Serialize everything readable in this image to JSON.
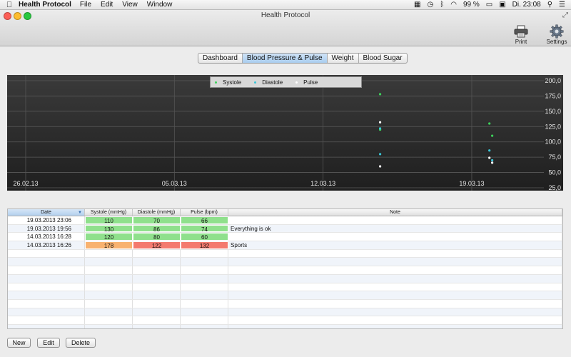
{
  "menubar": {
    "app_name": "Health Protocol",
    "items": [
      "File",
      "Edit",
      "View",
      "Window"
    ],
    "battery": "99 %",
    "clock": "Di. 23:08"
  },
  "window": {
    "title": "Health Protocol",
    "toolbar": {
      "print_label": "Print",
      "settings_label": "Settings"
    }
  },
  "tabs": [
    {
      "label": "Dashboard",
      "active": false
    },
    {
      "label": "Blood Pressure & Pulse",
      "active": true
    },
    {
      "label": "Weight",
      "active": false
    },
    {
      "label": "Blood Sugar",
      "active": false
    }
  ],
  "chart_data": {
    "type": "scatter",
    "legend": [
      {
        "name": "Systole",
        "color": "#3cd25a"
      },
      {
        "name": "Diastole",
        "color": "#39c6d8"
      },
      {
        "name": "Pulse",
        "color": "#ffffff"
      }
    ],
    "x_tick_labels": [
      "26.02.13",
      "05.03.13",
      "12.03.13",
      "19.03.13"
    ],
    "y_tick_labels": [
      "200,0",
      "175,0",
      "150,0",
      "125,0",
      "100,0",
      "75,0",
      "50,0",
      "25,0"
    ],
    "ylim": [
      25,
      200
    ],
    "xlim": [
      "2013-02-26",
      "2013-03-23"
    ],
    "series": [
      {
        "name": "Systole",
        "color": "#3cd25a",
        "points": [
          {
            "x": "2013-03-14 16:26",
            "y": 178
          },
          {
            "x": "2013-03-14 16:28",
            "y": 120
          },
          {
            "x": "2013-03-19 19:56",
            "y": 130
          },
          {
            "x": "2013-03-19 23:06",
            "y": 110
          }
        ]
      },
      {
        "name": "Diastole",
        "color": "#39c6d8",
        "points": [
          {
            "x": "2013-03-14 16:26",
            "y": 122
          },
          {
            "x": "2013-03-14 16:28",
            "y": 80
          },
          {
            "x": "2013-03-19 19:56",
            "y": 86
          },
          {
            "x": "2013-03-19 23:06",
            "y": 70
          }
        ]
      },
      {
        "name": "Pulse",
        "color": "#ffffff",
        "points": [
          {
            "x": "2013-03-14 16:26",
            "y": 132
          },
          {
            "x": "2013-03-14 16:28",
            "y": 60
          },
          {
            "x": "2013-03-19 19:56",
            "y": 74
          },
          {
            "x": "2013-03-19 23:06",
            "y": 66
          }
        ]
      }
    ]
  },
  "table": {
    "headers": [
      "Date",
      "Systole (mmHg)",
      "Diastole (mmHg)",
      "Pulse (bpm)",
      "Note"
    ],
    "sorted_column": "Date",
    "colors": {
      "normal": "#8fe08c",
      "elevated": "#f8b270",
      "high": "#f47a6f"
    },
    "rows": [
      {
        "date": "19.03.2013 23:06",
        "systole": "110",
        "diastole": "70",
        "pulse": "66",
        "note": "",
        "sys_status": "normal",
        "dia_status": "normal",
        "pul_status": "normal"
      },
      {
        "date": "19.03.2013 19:56",
        "systole": "130",
        "diastole": "86",
        "pulse": "74",
        "note": "Everything is ok",
        "sys_status": "normal",
        "dia_status": "normal",
        "pul_status": "normal"
      },
      {
        "date": "14.03.2013 16:28",
        "systole": "120",
        "diastole": "80",
        "pulse": "60",
        "note": "",
        "sys_status": "normal",
        "dia_status": "normal",
        "pul_status": "normal"
      },
      {
        "date": "14.03.2013 16:26",
        "systole": "178",
        "diastole": "122",
        "pulse": "132",
        "note": "Sports",
        "sys_status": "elevated",
        "dia_status": "high",
        "pul_status": "high"
      }
    ],
    "empty_rows": 10
  },
  "buttons": {
    "new": "New",
    "edit": "Edit",
    "delete": "Delete"
  }
}
